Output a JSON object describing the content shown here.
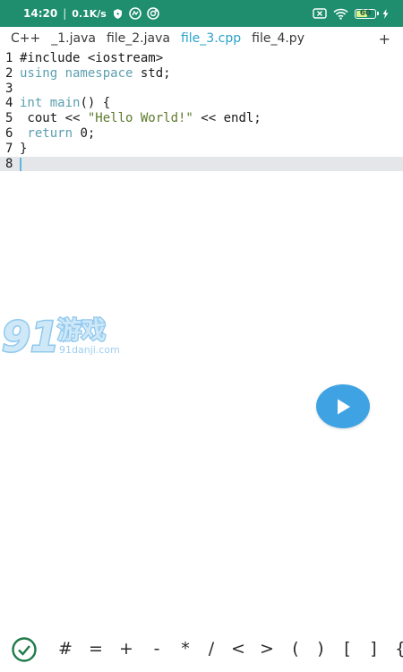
{
  "status_bar": {
    "time": "14:20",
    "separator": "|",
    "network_speed": "0.1K/s",
    "battery_level": "60",
    "battery_fraction": 0.6,
    "background_color": "#1e8e6e"
  },
  "tabs": [
    {
      "label": "C++",
      "active": false
    },
    {
      "label": "_1.java",
      "active": false
    },
    {
      "label": "file_2.java",
      "active": false
    },
    {
      "label": "file_3.cpp",
      "active": true
    },
    {
      "label": "file_4.py",
      "active": false
    }
  ],
  "tab_add_label": "+",
  "editor": {
    "lines": [
      {
        "number": "1",
        "tokens": [
          {
            "t": "#include <iostream>",
            "c": "plain"
          }
        ]
      },
      {
        "number": "2",
        "tokens": [
          {
            "t": "using namespace",
            "c": "kw"
          },
          {
            "t": " std;",
            "c": "plain"
          }
        ]
      },
      {
        "number": "3",
        "tokens": []
      },
      {
        "number": "4",
        "tokens": [
          {
            "t": "int main",
            "c": "kw"
          },
          {
            "t": "() {",
            "c": "plain"
          }
        ]
      },
      {
        "number": "5",
        "tokens": [
          {
            "t": " cout << ",
            "c": "plain"
          },
          {
            "t": "\"Hello World!\"",
            "c": "str"
          },
          {
            "t": " << endl;",
            "c": "plain"
          }
        ]
      },
      {
        "number": "6",
        "tokens": [
          {
            "t": " return",
            "c": "kw"
          },
          {
            "t": " 0;",
            "c": "plain"
          }
        ]
      },
      {
        "number": "7",
        "tokens": [
          {
            "t": "}",
            "c": "plain"
          }
        ]
      },
      {
        "number": "8",
        "tokens": []
      }
    ],
    "current_line": 7,
    "colors": {
      "keyword": "#5c9fb0",
      "string": "#5c7a2b",
      "current_line_bg": "#e4e6e9",
      "active_tab": "#2aa1c9"
    }
  },
  "watermark": {
    "logo_text": "91",
    "brand_text": "游戏",
    "domain_text": "91danji.com"
  },
  "run_button": {
    "icon": "play-icon",
    "color": "#3fa3e3"
  },
  "symbol_bar": {
    "confirm_icon": "check-circle-icon",
    "symbols": [
      "#",
      "=",
      "+",
      "-",
      "*",
      "/",
      "<",
      ">",
      "(",
      ")",
      "[",
      "]",
      "{"
    ]
  }
}
